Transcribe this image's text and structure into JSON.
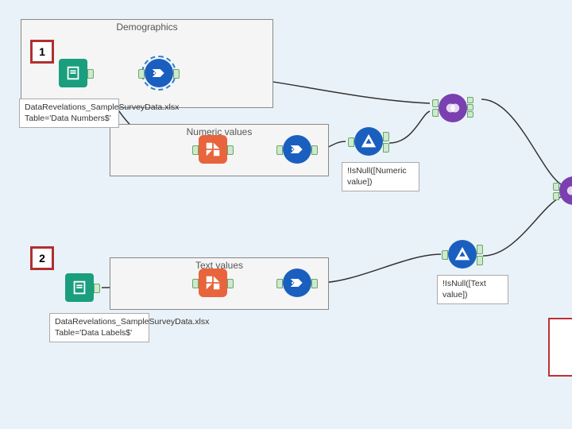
{
  "containers": {
    "demographics": {
      "title": "Demographics"
    },
    "numeric": {
      "title": "Numeric values"
    },
    "text": {
      "title": "Text values"
    }
  },
  "badges": {
    "one": "1",
    "two": "2"
  },
  "annotations": {
    "input1": "DataRevelations_SampleSurveyData.xlsx\nTable='Data Numbers$'",
    "input2": "DataRevelations_SampleSurveyData.xlsx\nTable='Data Labels$'",
    "filter1": "!IsNull([Numeric value])",
    "filter2": "!IsNull([Text value])"
  },
  "tools": {
    "input": "Input Data",
    "select": "Select",
    "transpose": "Transpose",
    "filter": "Filter",
    "join": "Join",
    "union": "Union"
  }
}
